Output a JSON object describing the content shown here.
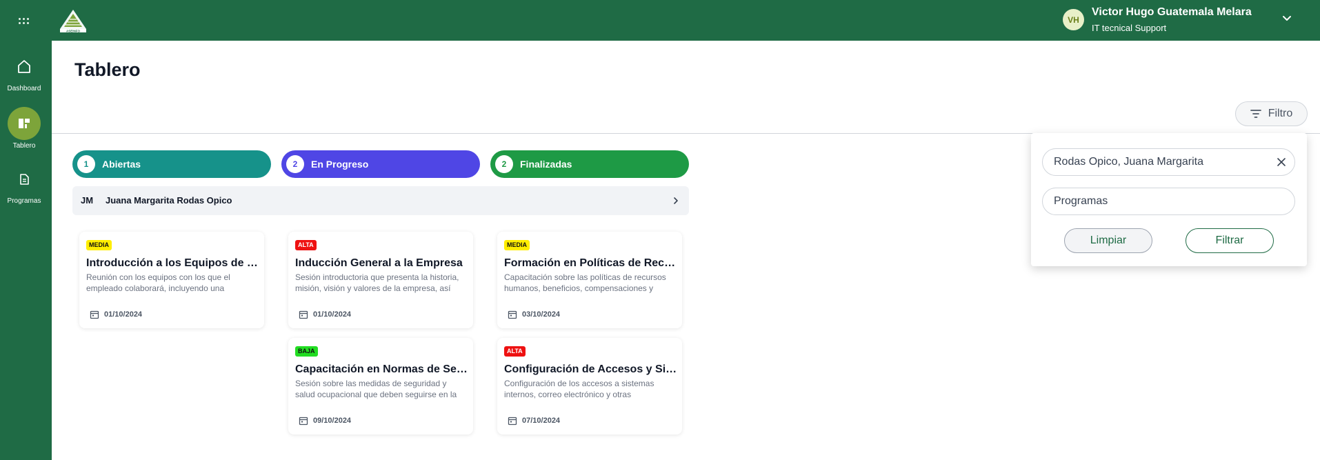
{
  "header": {
    "logo_text": "ASEINFO",
    "user": {
      "initials": "VH",
      "name": "Victor Hugo Guatemala Melara",
      "role": "IT tecnical Support"
    }
  },
  "sidebar": {
    "items": [
      {
        "label": "Dashboard",
        "icon": "home-icon",
        "active": false
      },
      {
        "label": "Tablero",
        "icon": "board-icon",
        "active": true
      },
      {
        "label": "Programas",
        "icon": "document-icon",
        "active": false
      }
    ]
  },
  "page": {
    "title": "Tablero",
    "filter_label": "Filtro"
  },
  "columns": [
    {
      "count": "1",
      "title": "Abiertas",
      "color": "#16928a"
    },
    {
      "count": "2",
      "title": "En Progreso",
      "color": "#4f46e5"
    },
    {
      "count": "2",
      "title": "Finalizadas",
      "color": "#1e9a45"
    }
  ],
  "group": {
    "initials": "JM",
    "name": "Juana Margarita Rodas Opico"
  },
  "cards": [
    {
      "priority": "MEDIA",
      "priority_color": "#ffee00",
      "priority_text_color": "#111111",
      "title": "Introducción a los Equipos de Trabajo",
      "description": "Reunión con los equipos con los que el empleado colaborará, incluyendo una presentación de sus funciones.",
      "date": "01/10/2024"
    },
    {
      "priority": "ALTA",
      "priority_color": "#ee1111",
      "priority_text_color": "#ffffff",
      "title": "Inducción General a la Empresa",
      "description": "Sesión introductoria que presenta la historia, misión, visión y valores de la empresa, así como su estructura.",
      "date": "01/10/2024"
    },
    {
      "priority": "MEDIA",
      "priority_color": "#ffee00",
      "priority_text_color": "#111111",
      "title": "Formación en Políticas de Recursos Humanos",
      "description": "Capacitación sobre las políticas de recursos humanos, beneficios, compensaciones y normativas internas.",
      "date": "03/10/2024"
    },
    {
      "priority": "BAJA",
      "priority_color": "#22dd22",
      "priority_text_color": "#111111",
      "title": "Capacitación en Normas de Seguridad",
      "description": "Sesión sobre las medidas de seguridad y salud ocupacional que deben seguirse en la empresa.",
      "date": "09/10/2024"
    },
    {
      "priority": "ALTA",
      "priority_color": "#ee1111",
      "priority_text_color": "#ffffff",
      "title": "Configuración de Accesos y Sistemas",
      "description": "Configuración de los accesos a sistemas internos, correo electrónico y otras herramientas de trabajo.",
      "date": "07/10/2024"
    }
  ],
  "filter_panel": {
    "employee_value": "Rodas Opico, Juana Margarita",
    "program_placeholder": "Programas",
    "clear_label": "Limpiar",
    "apply_label": "Filtrar"
  },
  "colors": {
    "brand_green": "#1f6b45",
    "active_nav": "#7da43a"
  }
}
